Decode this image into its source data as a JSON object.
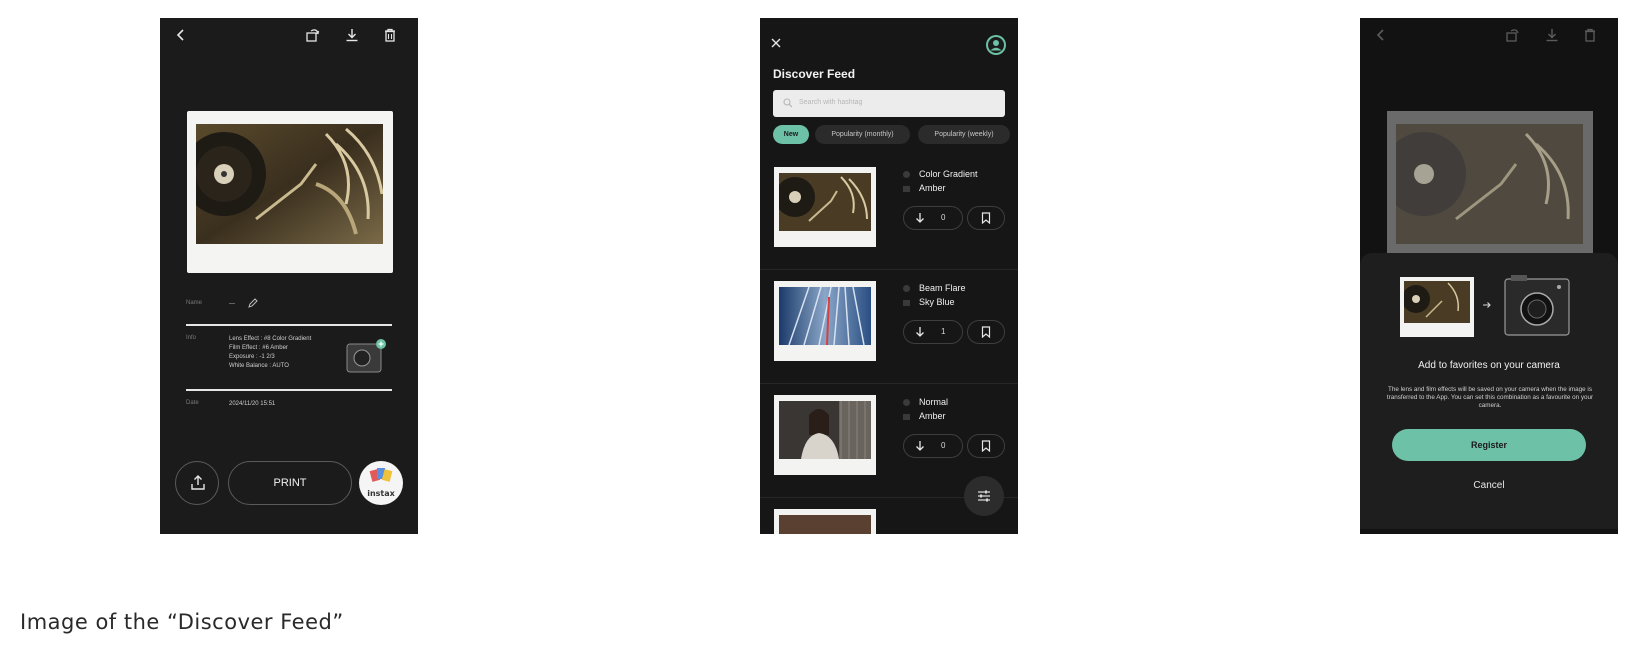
{
  "caption": "Image of the “Discover Feed”",
  "screen1": {
    "info": {
      "name_label": "Name",
      "name_value": "---",
      "info_label": "Info",
      "info_lines": [
        "Lens Effect : #8 Color Gradient",
        "Film Effect : #6 Amber",
        "Exposure : -1 2/3",
        "White Balance : AUTO"
      ],
      "date_label": "Date",
      "date_value": "2024/11/20 15:51"
    },
    "print_label": "PRINT",
    "instax_label": "instax"
  },
  "screen2": {
    "title": "Discover Feed",
    "search_placeholder": "Search with hashtag",
    "filters": [
      "New",
      "Popularity (monthly)",
      "Popularity (weekly)"
    ],
    "items": [
      {
        "lens": "Color Gradient",
        "film": "Amber",
        "downloads": "0"
      },
      {
        "lens": "Beam Flare",
        "film": "Sky Blue",
        "downloads": "1"
      },
      {
        "lens": "Normal",
        "film": "Amber",
        "downloads": "0"
      }
    ]
  },
  "screen3": {
    "sheet_title": "Add to favorites on your camera",
    "sheet_description": "The lens and film effects will be saved on your camera when the image is transferred to the App. You can set this combination as a favourite on your camera.",
    "register_label": "Register",
    "cancel_label": "Cancel"
  },
  "colors": {
    "accent": "#6cc1a6",
    "phone_bg": "#1b1b1b"
  }
}
